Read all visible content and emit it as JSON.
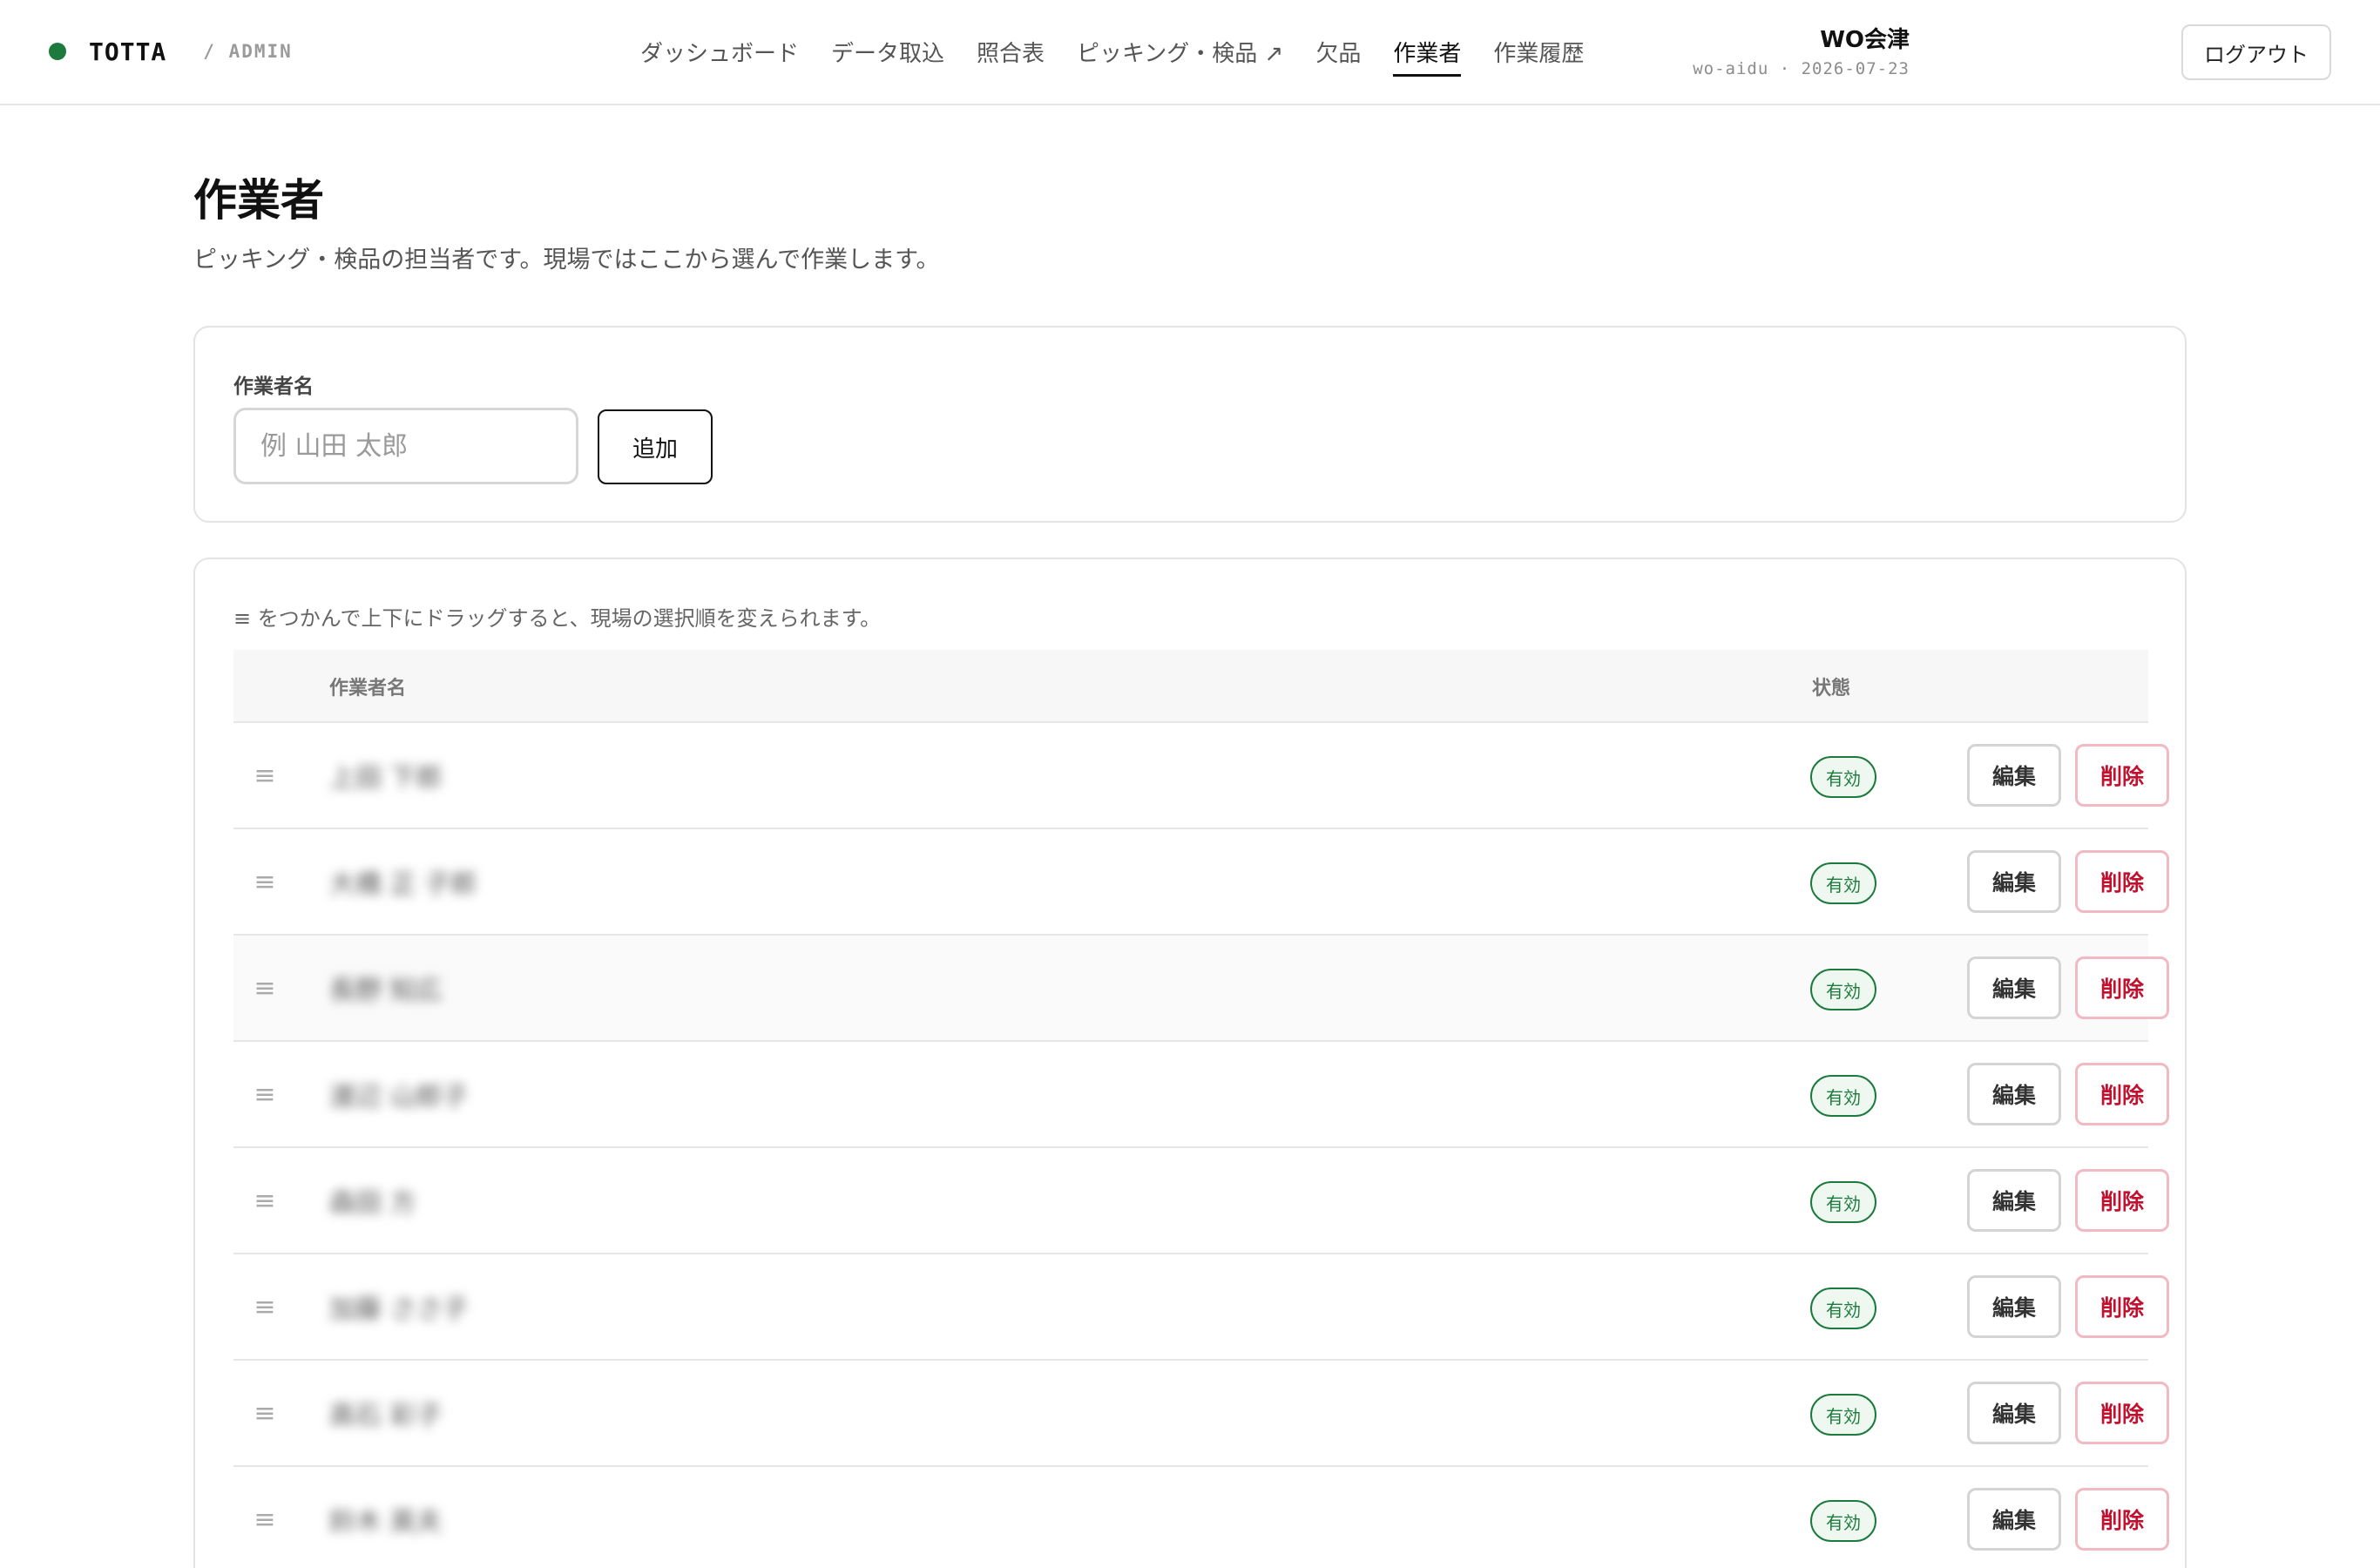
{
  "brand": {
    "name": "TOTTA",
    "section": "/ ADMIN",
    "dot_color": "#1b7a3c"
  },
  "nav": {
    "items": [
      {
        "label": "ダッシュボード",
        "active": false
      },
      {
        "label": "データ取込",
        "active": false
      },
      {
        "label": "照合表",
        "active": false
      },
      {
        "label": "ピッキング・検品 ↗",
        "active": false
      },
      {
        "label": "欠品",
        "active": false
      },
      {
        "label": "作業者",
        "active": true
      },
      {
        "label": "作業履歴",
        "active": false
      }
    ]
  },
  "account": {
    "name": "WO会津",
    "meta": "wo-aidu · 2026-07-23",
    "logout_label": "ログアウト"
  },
  "page": {
    "title": "作業者",
    "subtitle": "ピッキング・検品の担当者です。現場ではここから選んで作業します。"
  },
  "add_form": {
    "label": "作業者名",
    "placeholder": "例 山田 太郎",
    "value": "",
    "button_label": "追加"
  },
  "list": {
    "hint": "≡ をつかんで上下にドラッグすると、現場の選択順を変えられます。",
    "columns": {
      "name": "作業者名",
      "status": "状態"
    },
    "handle_glyph": "≡",
    "edit_label": "編集",
    "delete_label": "削除",
    "rows": [
      {
        "name": "上田 下郎",
        "status": "有効"
      },
      {
        "name": "大橋 正 子郎",
        "status": "有効"
      },
      {
        "name": "長野 知広",
        "status": "有効"
      },
      {
        "name": "渡辺 山郎子",
        "status": "有効"
      },
      {
        "name": "森田 方",
        "status": "有効"
      },
      {
        "name": "加藤 ささ子",
        "status": "有効"
      },
      {
        "name": "高石 彩子",
        "status": "有効"
      },
      {
        "name": "鈴木 英夫",
        "status": "有効"
      }
    ]
  },
  "colors": {
    "accent_green": "#1b7a3c",
    "danger_red": "#c2102f"
  }
}
